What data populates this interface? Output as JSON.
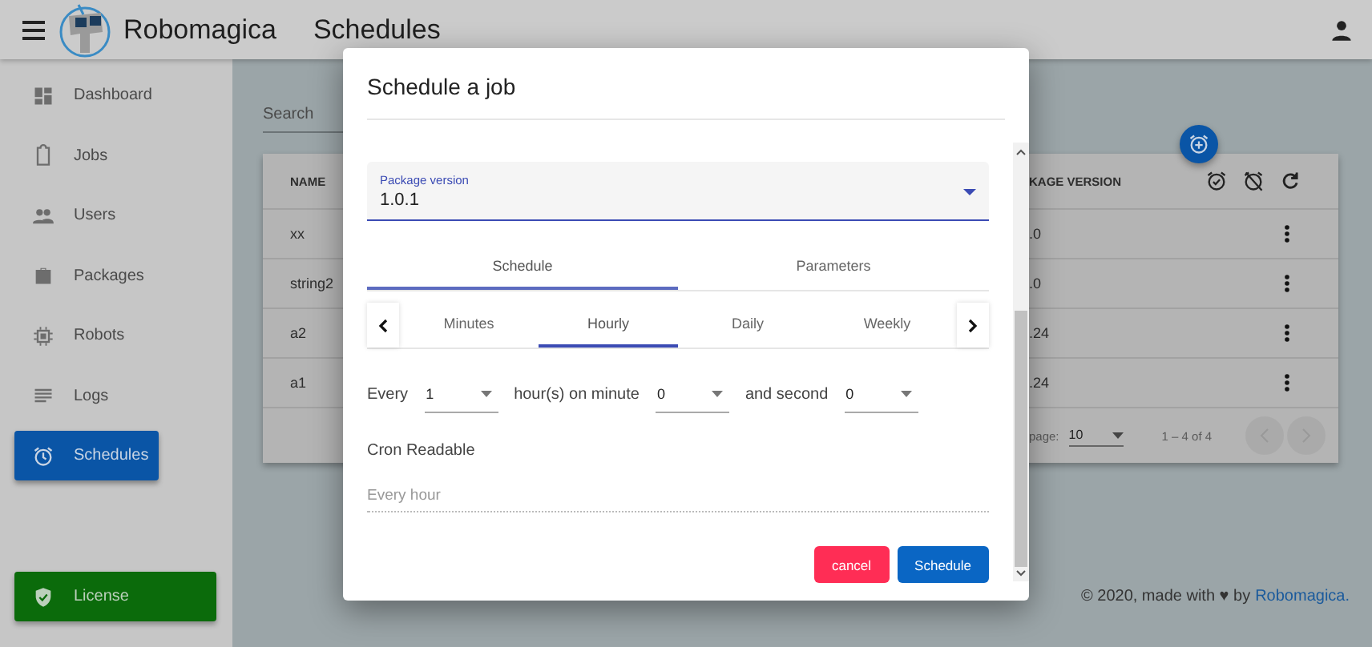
{
  "app_bar": {
    "brand": "Robomagica",
    "page_title": "Schedules"
  },
  "sidebar": {
    "items": [
      {
        "label": "Dashboard",
        "selected": false
      },
      {
        "label": "Jobs",
        "selected": false
      },
      {
        "label": "Users",
        "selected": false
      },
      {
        "label": "Packages",
        "selected": false
      },
      {
        "label": "Robots",
        "selected": false
      },
      {
        "label": "Logs",
        "selected": false
      },
      {
        "label": "Schedules",
        "selected": true
      }
    ],
    "license": "License"
  },
  "search": {
    "placeholder": "Search"
  },
  "table": {
    "columns": [
      "NAME",
      "KAGE VERSION"
    ],
    "rows": [
      {
        "name": "xx",
        "version": ".0"
      },
      {
        "name": "string2",
        "version": ".0"
      },
      {
        "name": "a2",
        "version": ".24"
      },
      {
        "name": "a1",
        "version": ".24"
      }
    ],
    "paginator": {
      "per_page_label": "page:",
      "per_page": "10",
      "range": "1 – 4 of 4"
    }
  },
  "footer": {
    "text": "© 2020, made with ♥ by",
    "link": "Robomagica."
  },
  "dialog": {
    "title": "Schedule a job",
    "package_field": {
      "label": "Package version",
      "value": "1.0.1"
    },
    "tabs": [
      {
        "label": "Schedule",
        "selected": true
      },
      {
        "label": "Parameters",
        "selected": false
      }
    ],
    "periods": [
      {
        "label": "Minutes",
        "selected": false
      },
      {
        "label": "Hourly",
        "selected": true
      },
      {
        "label": "Daily",
        "selected": false
      },
      {
        "label": "Weekly",
        "selected": false
      }
    ],
    "rule": [
      {
        "kind": "label",
        "text": "Every"
      },
      {
        "kind": "select",
        "value": "1"
      },
      {
        "kind": "label",
        "text": "hour(s) on minute"
      },
      {
        "kind": "select",
        "value": "0"
      },
      {
        "kind": "label",
        "text": "and second"
      },
      {
        "kind": "select",
        "value": "0"
      }
    ],
    "cron_label": "Cron Readable",
    "cron_placeholder": "Every hour",
    "buttons": [
      {
        "label": "cancel",
        "kind": "warn"
      },
      {
        "label": "Schedule",
        "kind": "primary"
      }
    ]
  }
}
